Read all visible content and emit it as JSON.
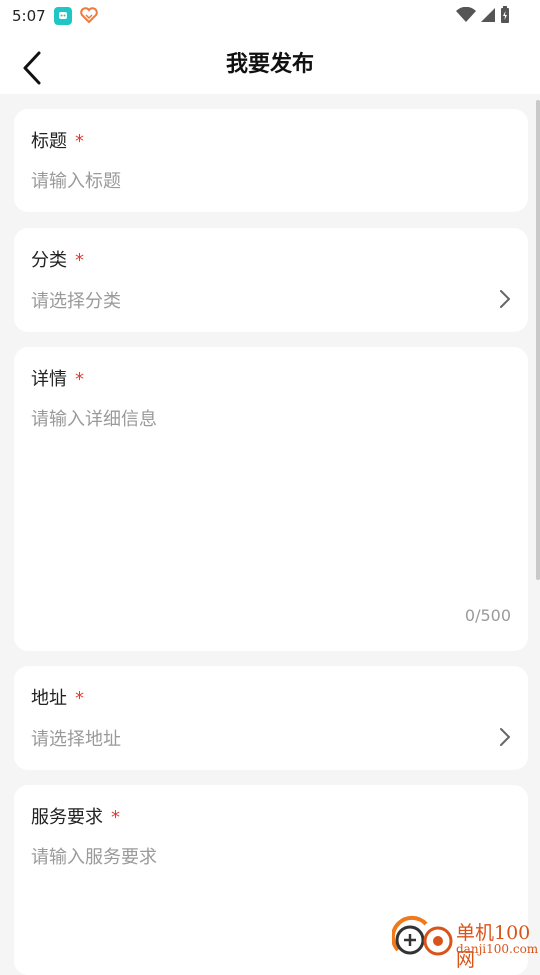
{
  "status_bar": {
    "time": "5:07"
  },
  "header": {
    "title": "我要发布"
  },
  "form": {
    "title": {
      "label": "标题",
      "required_mark": "*",
      "placeholder": "请输入标题"
    },
    "category": {
      "label": "分类",
      "required_mark": "*",
      "placeholder": "请选择分类"
    },
    "details": {
      "label": "详情",
      "required_mark": "*",
      "placeholder": "请输入详细信息",
      "counter": "0/500"
    },
    "address": {
      "label": "地址",
      "required_mark": "*",
      "placeholder": "请选择地址"
    },
    "service": {
      "label": "服务要求",
      "required_mark": "*",
      "placeholder": "请输入服务要求"
    }
  },
  "watermark": {
    "name": "单机100网",
    "site": "danji100.com"
  },
  "colors": {
    "required": "#e53935",
    "placeholder": "#9a9a9a",
    "background": "#f5f5f5",
    "card": "#ffffff"
  }
}
